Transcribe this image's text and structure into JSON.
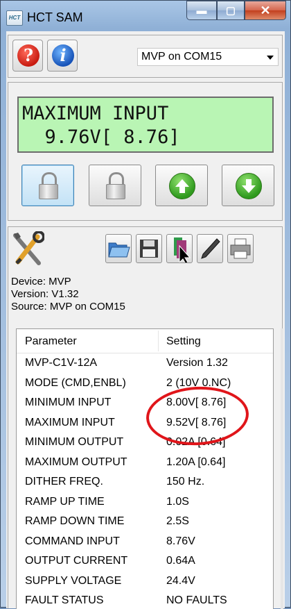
{
  "window": {
    "title": "HCT SAM",
    "icon_text": "HCT"
  },
  "toolbar": {
    "port_selected": "MVP on COM15"
  },
  "lcd": {
    "line1": "MAXIMUM INPUT",
    "line2": "  9.76V[ 8.76]"
  },
  "device": {
    "device_line": "Device: MVP",
    "version_line": "Version: V1.32",
    "source_line": "Source: MVP on COM15"
  },
  "table": {
    "headers": {
      "parameter": "Parameter",
      "setting": "Setting"
    },
    "rows": [
      {
        "parameter": "MVP-C1V-12A",
        "setting": "Version 1.32"
      },
      {
        "parameter": "MODE (CMD,ENBL)",
        "setting": "2 (10V 0.NC)"
      },
      {
        "parameter": "MINIMUM INPUT",
        "setting": "8.00V[ 8.76]"
      },
      {
        "parameter": "MAXIMUM INPUT",
        "setting": "9.52V[ 8.76]"
      },
      {
        "parameter": "MINIMUM OUTPUT",
        "setting": "0.02A  [0.64]"
      },
      {
        "parameter": "MAXIMUM OUTPUT",
        "setting": "1.20A  [0.64]"
      },
      {
        "parameter": "DITHER FREQ.",
        "setting": "150 Hz."
      },
      {
        "parameter": "RAMP UP TIME",
        "setting": "1.0S"
      },
      {
        "parameter": "RAMP DOWN TIME",
        "setting": "2.5S"
      },
      {
        "parameter": "COMMAND INPUT",
        "setting": "8.76V"
      },
      {
        "parameter": "OUTPUT CURRENT",
        "setting": "0.64A"
      },
      {
        "parameter": "SUPPLY VOLTAGE",
        "setting": "24.4V"
      },
      {
        "parameter": "FAULT STATUS",
        "setting": "NO FAULTS"
      }
    ]
  },
  "colors": {
    "lcd_background": "#b9f5b4",
    "annotation_circle": "#e0151a",
    "selected_button": "#c3e2f6"
  }
}
